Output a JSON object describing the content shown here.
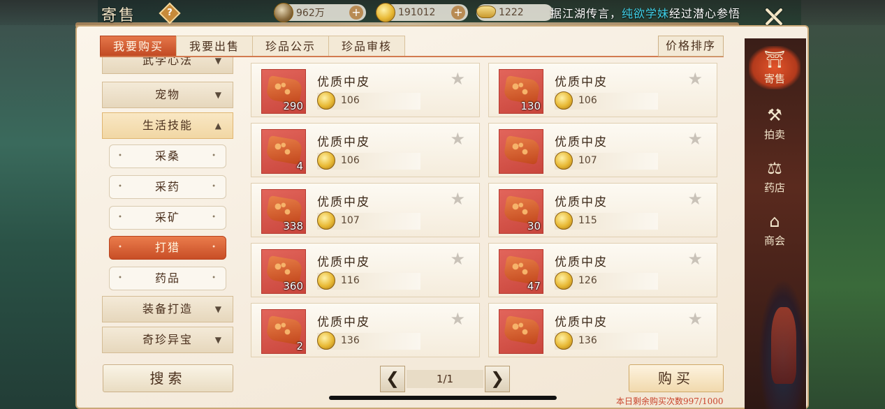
{
  "header": {
    "title": "寄售",
    "help_symbol": "?",
    "resources": [
      {
        "icon": "copper-coin-icon",
        "value": "962万"
      },
      {
        "icon": "gold-coin-icon",
        "value": "191012"
      },
      {
        "icon": "gold-ingot-icon",
        "value": "1222"
      }
    ],
    "marquee_prefix": "据江湖传言，",
    "marquee_name": "纯欲学妹",
    "marquee_suffix": "经过潜心参悟"
  },
  "tabs": [
    {
      "label": "我要购买",
      "active": true
    },
    {
      "label": "我要出售",
      "active": false
    },
    {
      "label": "珍品公示",
      "active": false
    },
    {
      "label": "珍品审核",
      "active": false
    }
  ],
  "sort_label": "价格排序",
  "categories": {
    "martial": "武学心法",
    "pets": "宠物",
    "life_skills": "生活技能",
    "sub": [
      "采桑",
      "采药",
      "采矿",
      "打猎",
      "药品"
    ],
    "active_sub": "打猎",
    "equipment": "装备打造",
    "treasures": "奇珍异宝"
  },
  "search_label": "搜索",
  "items": [
    {
      "name": "优质中皮",
      "qty": "290",
      "price": "106"
    },
    {
      "name": "优质中皮",
      "qty": "130",
      "price": "106"
    },
    {
      "name": "优质中皮",
      "qty": "4",
      "price": "106"
    },
    {
      "name": "优质中皮",
      "qty": "",
      "price": "107"
    },
    {
      "name": "优质中皮",
      "qty": "338",
      "price": "107"
    },
    {
      "name": "优质中皮",
      "qty": "30",
      "price": "115"
    },
    {
      "name": "优质中皮",
      "qty": "360",
      "price": "116"
    },
    {
      "name": "优质中皮",
      "qty": "47",
      "price": "126"
    },
    {
      "name": "优质中皮",
      "qty": "2",
      "price": "136"
    },
    {
      "name": "优质中皮",
      "qty": "",
      "price": "136"
    }
  ],
  "pager": {
    "prev": "❮",
    "text": "1/1",
    "next": "❯"
  },
  "buy_label": "购买",
  "quota_text": "本日剩余购买次数997/1000",
  "sidenav": [
    {
      "label": "寄售",
      "icon": "pavilion-icon",
      "active": true
    },
    {
      "label": "拍卖",
      "icon": "gavel-icon",
      "active": false
    },
    {
      "label": "药店",
      "icon": "scale-icon",
      "active": false
    },
    {
      "label": "商会",
      "icon": "guild-icon",
      "active": false
    }
  ],
  "colors": {
    "accent": "#c84e26",
    "panel": "#f6ede0",
    "quota": "#c9442c"
  }
}
